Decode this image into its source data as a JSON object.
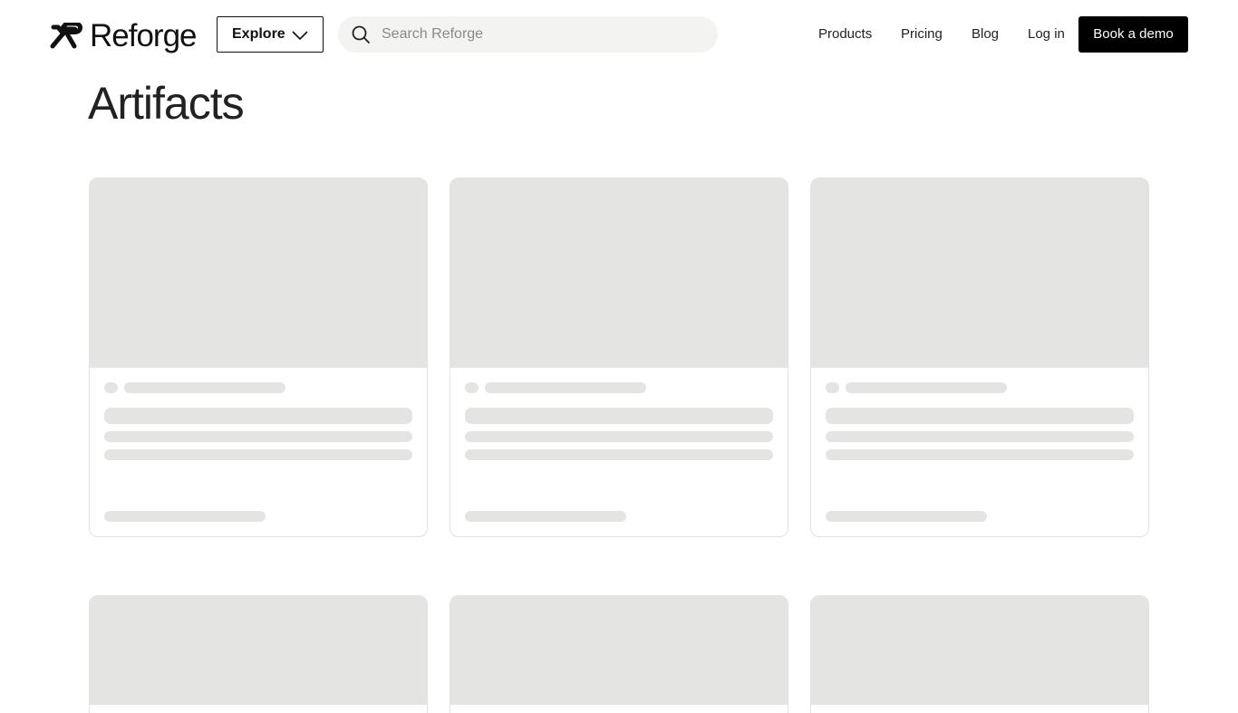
{
  "header": {
    "logo_text": "Reforge",
    "explore_label": "Explore",
    "search_placeholder": "Search Reforge",
    "nav": {
      "products": "Products",
      "pricing": "Pricing",
      "blog": "Blog",
      "login": "Log in"
    },
    "cta_label": "Book a demo",
    "icons": {
      "logo": "reforge-logo-icon",
      "explore": "chevron-down-icon",
      "search": "search-icon"
    }
  },
  "main": {
    "title": "Artifacts",
    "cards_state": "loading-skeleton"
  },
  "colors": {
    "background": "#ffffff",
    "text": "#111111",
    "skeleton": "#e4e4e3",
    "search_bg": "#f3f3f1",
    "cta_bg": "#000000",
    "cta_text": "#ffffff",
    "card_border": "#e2e2e0"
  }
}
